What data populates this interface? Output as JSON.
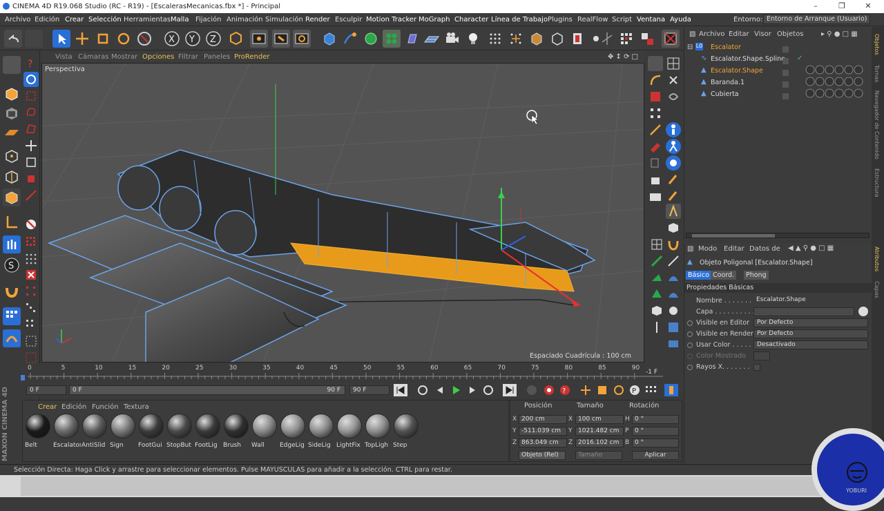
{
  "window": {
    "title": "CINEMA 4D R19.068 Studio (RC - R19) - [EscalerasMecanicas.fbx *] - Principal"
  },
  "menubar": {
    "items": [
      "Archivo",
      "Edición",
      "Crear",
      "Selección",
      "Herramientas",
      "Malla",
      "Fijación",
      "Animación",
      "Simulación",
      "Render",
      "Esculpir",
      "Motion Tracker",
      "MoGraph",
      "Character",
      "Línea de Trabajo",
      "Plugins",
      "RealFlow",
      "Script",
      "Ventana",
      "Ayuda"
    ],
    "layout_label": "Entorno:",
    "layout_value": "Entorno de Arranque (Usuario)"
  },
  "viewport": {
    "menu": [
      "Vista",
      "Cámaras",
      "Mostrar",
      "Opciones",
      "Filtrar",
      "Paneles",
      "ProRender"
    ],
    "label": "Perspectiva",
    "grid_spacing": "Espaciado Cuadrícula : 100 cm"
  },
  "timeline": {
    "ticks": [
      "0",
      "5",
      "10",
      "15",
      "20",
      "25",
      "30",
      "35",
      "40",
      "45",
      "50",
      "55",
      "60",
      "65",
      "70",
      "75",
      "80",
      "85",
      "90"
    ],
    "current_frame": "-1 F",
    "start_field": "0 F",
    "slider_start": "0 F",
    "slider_end": "90 F",
    "end_field": "90 F"
  },
  "materials": {
    "menu": [
      "Crear",
      "Edición",
      "Función",
      "Textura"
    ],
    "items": [
      {
        "name": "Belt",
        "color": "#1a1a1a"
      },
      {
        "name": "Escalator",
        "color": "#6a6a6a"
      },
      {
        "name": "AntiSlid",
        "color": "#5a5a5a"
      },
      {
        "name": "Sign",
        "color": "#7a7a7a"
      },
      {
        "name": "FootGui",
        "color": "#3c3c3c"
      },
      {
        "name": "StopBut",
        "color": "#4a4a4a"
      },
      {
        "name": "FootLig",
        "color": "#3a3a3a"
      },
      {
        "name": "Brush",
        "color": "#303030"
      },
      {
        "name": "Wall",
        "color": "#8a8a8a"
      },
      {
        "name": "EdgeLig",
        "color": "#909090"
      },
      {
        "name": "SideLig",
        "color": "#8c8c8c"
      },
      {
        "name": "LightFix",
        "color": "#959595"
      },
      {
        "name": "TopLigh",
        "color": "#8e8e8e"
      },
      {
        "name": "Step",
        "color": "#525252"
      }
    ]
  },
  "coords": {
    "headers": [
      "Posición",
      "Tamaño",
      "Rotación"
    ],
    "rows": [
      {
        "axis": "X",
        "pos": "200 cm",
        "size": "100 cm",
        "rot_label": "H",
        "rot": "0 °"
      },
      {
        "axis": "Y",
        "pos": "-511.039 cm",
        "size": "1021.482 cm",
        "rot_label": "P",
        "rot": "0 °"
      },
      {
        "axis": "Z",
        "pos": "863.049 cm",
        "size": "2016.102 cm",
        "rot_label": "B",
        "rot": "0 °"
      }
    ],
    "mode": "Objeto (Rel)",
    "size_mode": "Tamaño",
    "apply": "Aplicar"
  },
  "objects": {
    "menu": [
      "Archivo",
      "Editar",
      "Visor",
      "Objetos"
    ],
    "rows": [
      {
        "name": "Escalator",
        "selected": true
      },
      {
        "name": "Escalator.Shape.Spline",
        "selected": false
      },
      {
        "name": "Escalator.Shape",
        "selected": true
      },
      {
        "name": "Baranda.1",
        "selected": false
      },
      {
        "name": "Cubierta",
        "selected": false
      }
    ]
  },
  "attributes": {
    "menu": [
      "Modo",
      "Editar",
      "Datos de"
    ],
    "object_title": "Objeto Poligonal [Escalator.Shape]",
    "tabs": [
      "Básico",
      "Coord.",
      "Phong"
    ],
    "section": "Propiedades Básicas",
    "fields": [
      {
        "label": "Nombre . . . . . . . .",
        "value": "Escalator.Shape"
      },
      {
        "label": "Capa . . . . . . . . . .",
        "value": ""
      },
      {
        "label": "Visible en Editor",
        "value": "Por Defecto"
      },
      {
        "label": "Visible en Render",
        "value": "Por Defecto"
      },
      {
        "label": "Usar Color . . . . .",
        "value": "Desactivado"
      },
      {
        "label": "Color Mostrado",
        "value": ""
      },
      {
        "label": "Rayos X. . . . . . .",
        "value": ""
      }
    ]
  },
  "side_tabs": [
    "Objetos",
    "Tomas",
    "Navegador de Contenido",
    "Estructura",
    "Atributos",
    "Capas"
  ],
  "status": "Selección Directa: Haga Click y arrastre para seleccionar elementos. Pulse MAYUSCULAS para añadir a la selección. CTRL para restar.",
  "branding": {
    "left": "MAXON CINEMA 4D",
    "circle": "YOBURI"
  },
  "colors": {
    "accent": "#f3a43a",
    "selection_blue": "#2a6fd6",
    "highlight_yellow": "#e8c25a"
  }
}
